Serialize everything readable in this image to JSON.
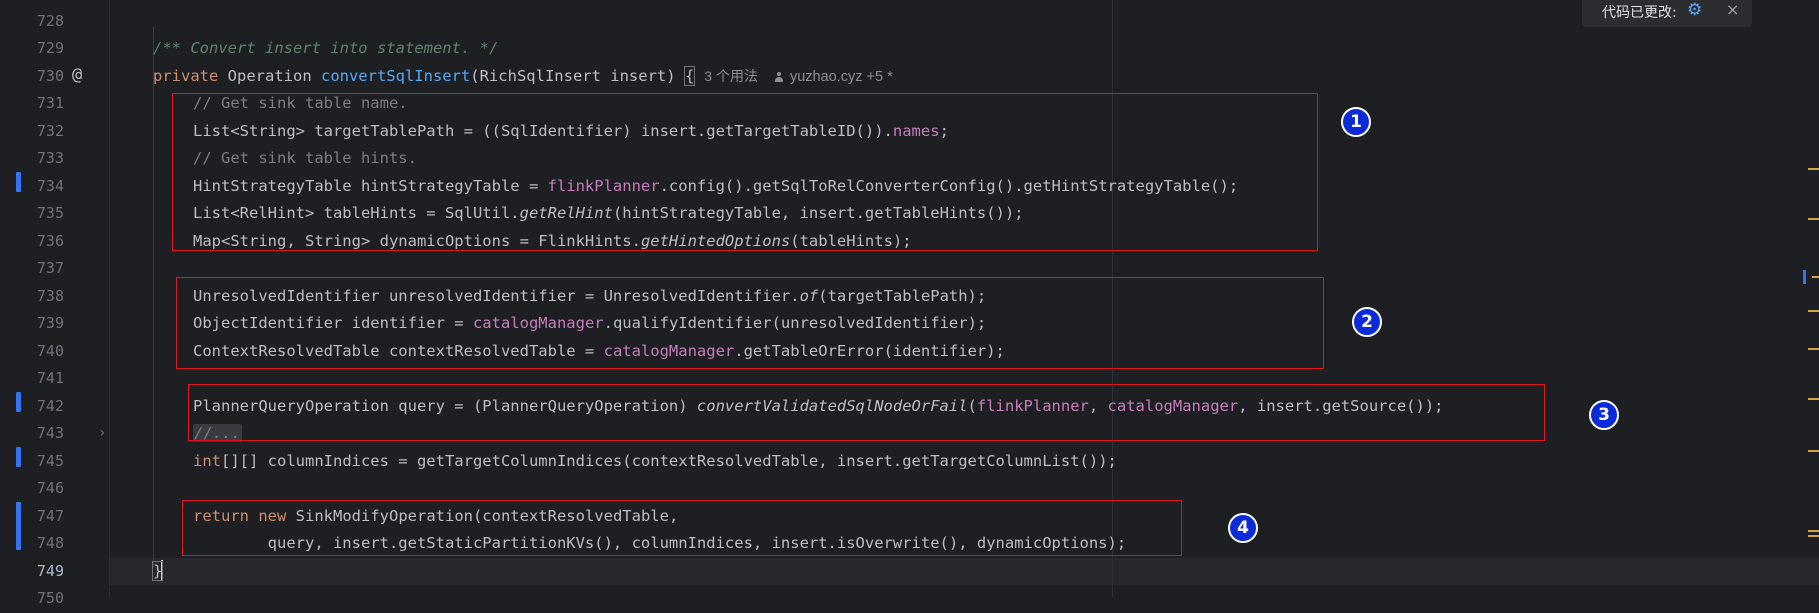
{
  "editor": {
    "line_numbers": [
      "728",
      "729",
      "730",
      "731",
      "732",
      "733",
      "734",
      "735",
      "736",
      "737",
      "738",
      "739",
      "740",
      "741",
      "742",
      "743",
      "745",
      "746",
      "747",
      "748",
      "749",
      "750"
    ],
    "current_line": "749",
    "inlay_hints": {
      "usages": "3 个用法",
      "author": "yuzhao.cyz +5 *"
    },
    "gutter_at_icon": "@",
    "fold_arrow": "›",
    "lines": {
      "l729": "/** Convert insert into statement. */",
      "l730_kw": "private",
      "l730_type": " Operation ",
      "l730_name": "convertSqlInsert",
      "l730_params": "(RichSqlInsert insert) ",
      "l730_brace": "{",
      "l731": "// Get sink table name.",
      "l732_a": "List<String> targetTablePath = ((SqlIdentifier) insert.getTargetTableID()).",
      "l732_field": "names",
      "l732_b": ";",
      "l733": "// Get sink table hints.",
      "l734_a": "HintStrategyTable hintStrategyTable = ",
      "l734_field": "flinkPlanner",
      "l734_b": ".config().getSqlToRelConverterConfig().getHintStrategyTable();",
      "l735_a": "List<RelHint> tableHints = SqlUtil.",
      "l735_it": "getRelHint",
      "l735_b": "(hintStrategyTable, insert.getTableHints());",
      "l736_a": "Map<String, String> dynamicOptions = FlinkHints.",
      "l736_it": "getHintedOptions",
      "l736_b": "(tableHints);",
      "l738_a": "UnresolvedIdentifier unresolvedIdentifier = UnresolvedIdentifier.",
      "l738_it": "of",
      "l738_b": "(targetTablePath);",
      "l739_a": "ObjectIdentifier identifier = ",
      "l739_field": "catalogManager",
      "l739_b": ".qualifyIdentifier(unresolvedIdentifier);",
      "l740_a": "ContextResolvedTable contextResolvedTable = ",
      "l740_field": "catalogManager",
      "l740_b": ".getTableOrError(identifier);",
      "l742_a": "PlannerQueryOperation query = (PlannerQueryOperation) ",
      "l742_it": "convertValidatedSqlNodeOrFail",
      "l742_b": "(",
      "l742_f1": "flinkPlanner",
      "l742_c": ", ",
      "l742_f2": "catalogManager",
      "l742_d": ", insert.getSource());",
      "l743": "//...",
      "l745_kw": "int",
      "l745_b": "[][] columnIndices = getTargetColumnIndices(contextResolvedTable, insert.getTargetColumnList());",
      "l747_kw1": "return",
      "l747_kw2": "new",
      "l747_b": " SinkModifyOperation(contextResolvedTable,",
      "l748": "        query, insert.getStaticPartitionKVs(), columnIndices, insert.isOverwrite(), dynamicOptions);",
      "l749": "}"
    }
  },
  "annotations": [
    "1",
    "2",
    "3",
    "4"
  ],
  "notification": {
    "text": "代码已更改:",
    "icon": "settings-sync-icon",
    "close": "×"
  },
  "colors": {
    "annot_border": "#e0141e",
    "badge_fill": "#0b2ad8",
    "vcs_modified": "#3574f0"
  }
}
